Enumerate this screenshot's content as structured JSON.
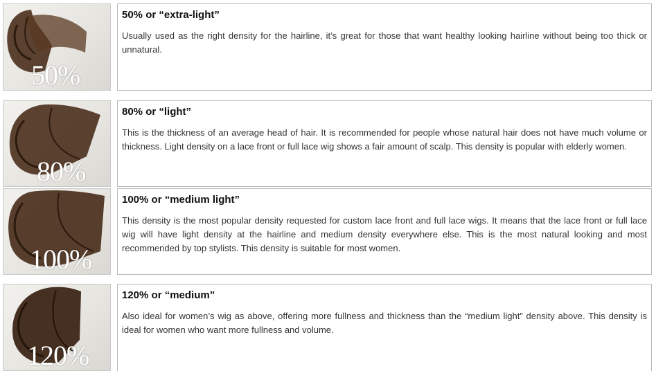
{
  "hair_color": "#3d2616",
  "rows": [
    {
      "label": "50%",
      "title": "50% or “extra-light”",
      "text": "Usually used as the right density for the hairline, it’s great for those that want healthy looking hairline without being too thick or unnatural."
    },
    {
      "label": "80%",
      "title": "80% or “light”",
      "text": "This is the thickness of an average head of hair. It is recommended for people whose natural hair does not have much volume or thickness. Light density on a lace front or full lace wig shows a fair amount of scalp. This density is popular with elderly women."
    },
    {
      "label": "100%",
      "title": "100% or “medium light”",
      "text": "This density is the most popular density requested for custom lace front and full lace wigs. It means that the lace front or full lace wig will have light density at the hairline and medium density everywhere else. This is the most natural looking and most recommended by top stylists. This density is suitable for most women."
    },
    {
      "label": "120%",
      "title": "120% or “medium”",
      "text": "Also ideal for women’s wig as above, offering more fullness and thickness than the “medium light” density above. This density is ideal for women who want more fullness and volume."
    }
  ]
}
